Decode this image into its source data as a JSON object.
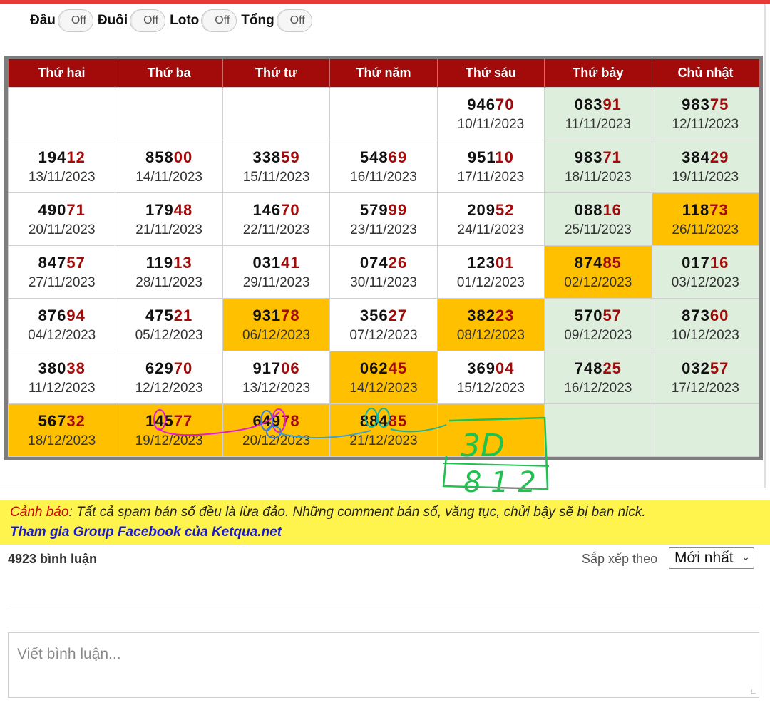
{
  "filters": [
    {
      "label": "Đầu",
      "state": "Off"
    },
    {
      "label": "Đuôi",
      "state": "Off"
    },
    {
      "label": "Loto",
      "state": "Off"
    },
    {
      "label": "Tổng",
      "state": "Off"
    }
  ],
  "calendar": {
    "days": [
      "Thứ hai",
      "Thứ ba",
      "Thứ tư",
      "Thứ năm",
      "Thứ sáu",
      "Thứ bảy",
      "Chủ nhật"
    ],
    "weeks": [
      [
        null,
        null,
        null,
        null,
        {
          "head": "946",
          "tail": "70",
          "date": "10/11/2023"
        },
        {
          "head": "083",
          "tail": "91",
          "date": "11/11/2023"
        },
        {
          "head": "983",
          "tail": "75",
          "date": "12/11/2023"
        }
      ],
      [
        {
          "head": "194",
          "tail": "12",
          "date": "13/11/2023"
        },
        {
          "head": "858",
          "tail": "00",
          "date": "14/11/2023"
        },
        {
          "head": "338",
          "tail": "59",
          "date": "15/11/2023"
        },
        {
          "head": "548",
          "tail": "69",
          "date": "16/11/2023"
        },
        {
          "head": "951",
          "tail": "10",
          "date": "17/11/2023"
        },
        {
          "head": "983",
          "tail": "71",
          "date": "18/11/2023"
        },
        {
          "head": "384",
          "tail": "29",
          "date": "19/11/2023"
        }
      ],
      [
        {
          "head": "490",
          "tail": "71",
          "date": "20/11/2023"
        },
        {
          "head": "179",
          "tail": "48",
          "date": "21/11/2023"
        },
        {
          "head": "146",
          "tail": "70",
          "date": "22/11/2023"
        },
        {
          "head": "579",
          "tail": "99",
          "date": "23/11/2023"
        },
        {
          "head": "209",
          "tail": "52",
          "date": "24/11/2023"
        },
        {
          "head": "088",
          "tail": "16",
          "date": "25/11/2023"
        },
        {
          "head": "118",
          "tail": "73",
          "date": "26/11/2023",
          "highlight": true
        }
      ],
      [
        {
          "head": "847",
          "tail": "57",
          "date": "27/11/2023"
        },
        {
          "head": "119",
          "tail": "13",
          "date": "28/11/2023"
        },
        {
          "head": "031",
          "tail": "41",
          "date": "29/11/2023"
        },
        {
          "head": "074",
          "tail": "26",
          "date": "30/11/2023"
        },
        {
          "head": "123",
          "tail": "01",
          "date": "01/12/2023"
        },
        {
          "head": "874",
          "tail": "85",
          "date": "02/12/2023",
          "highlight": true
        },
        {
          "head": "017",
          "tail": "16",
          "date": "03/12/2023"
        }
      ],
      [
        {
          "head": "876",
          "tail": "94",
          "date": "04/12/2023"
        },
        {
          "head": "475",
          "tail": "21",
          "date": "05/12/2023"
        },
        {
          "head": "931",
          "tail": "78",
          "date": "06/12/2023",
          "highlight": true
        },
        {
          "head": "356",
          "tail": "27",
          "date": "07/12/2023"
        },
        {
          "head": "382",
          "tail": "23",
          "date": "08/12/2023",
          "highlight": true
        },
        {
          "head": "570",
          "tail": "57",
          "date": "09/12/2023"
        },
        {
          "head": "873",
          "tail": "60",
          "date": "10/12/2023"
        }
      ],
      [
        {
          "head": "380",
          "tail": "38",
          "date": "11/12/2023"
        },
        {
          "head": "629",
          "tail": "70",
          "date": "12/12/2023"
        },
        {
          "head": "917",
          "tail": "06",
          "date": "13/12/2023"
        },
        {
          "head": "062",
          "tail": "45",
          "date": "14/12/2023",
          "highlight": true
        },
        {
          "head": "369",
          "tail": "04",
          "date": "15/12/2023"
        },
        {
          "head": "748",
          "tail": "25",
          "date": "16/12/2023"
        },
        {
          "head": "032",
          "tail": "57",
          "date": "17/12/2023"
        }
      ],
      [
        {
          "head": "567",
          "tail": "32",
          "date": "18/12/2023",
          "highlight": true
        },
        {
          "head": "145",
          "tail": "77",
          "date": "19/12/2023",
          "highlight": true
        },
        {
          "head": "649",
          "tail": "78",
          "date": "20/12/2023",
          "highlight": true
        },
        {
          "head": "884",
          "tail": "85",
          "date": "21/12/2023",
          "highlight": true
        },
        {
          "empty": true,
          "highlight": true
        },
        {
          "empty": true
        },
        {
          "empty": true
        }
      ]
    ]
  },
  "annotation": {
    "line1": "3D",
    "line2": "8 1 2"
  },
  "warning": {
    "label": "Cảnh báo",
    "text": ": Tất cả spam bán số đều là lừa đảo. Những comment bán số, văng tục, chửi bậy sẽ bị ban nick.",
    "link": "Tham gia Group Facebook của Ketqua.net"
  },
  "comments": {
    "count_label": "4923 bình luận",
    "sort_label": "Sắp xếp theo",
    "sort_value": "Mới nhất",
    "input_placeholder": "Viết bình luận..."
  },
  "colors": {
    "header_bg": "#a30a0a",
    "highlight": "#ffc000",
    "weekend": "#ddeedd",
    "warning_bg": "#fff34d"
  }
}
